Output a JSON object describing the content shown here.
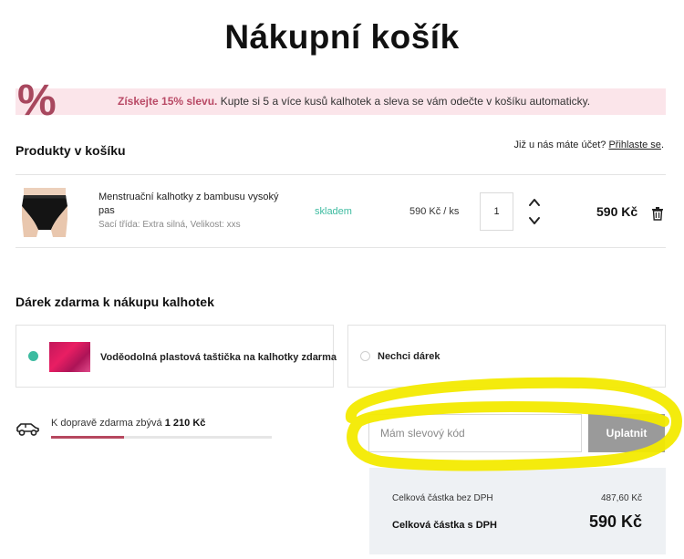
{
  "page": {
    "title": "Nákupní košík"
  },
  "promo": {
    "icon": "percent-icon",
    "symbol": "%",
    "strong": "Získejte 15% slevu.",
    "text": " Kupte si 5 a více kusů kalhotek a sleva se vám odečte v košíku automaticky.",
    "accent_color": "#b94a66",
    "background": "#fbe5ea"
  },
  "cart": {
    "heading": "Produkty v košíku",
    "login_prompt": "Již u nás máte účet? ",
    "login_link": "Přihlaste se",
    "login_suffix": ".",
    "items": [
      {
        "name": "Menstruační kalhotky z bambusu vysoký pas",
        "meta": "Sací třída: Extra silná, Velikost: xxs",
        "stock": "skladem",
        "unit_price": "590 Kč / ks",
        "quantity": "1",
        "total": "590 Kč",
        "icons": [
          "chevron-up-icon",
          "chevron-down-icon",
          "trash-icon"
        ]
      }
    ]
  },
  "gift": {
    "heading": "Dárek zdarma k nákupu kalhotek",
    "options": [
      {
        "label": "Voděodolná plastová taštička na kalhotky  zdarma",
        "selected": true
      },
      {
        "label": "Nechci dárek",
        "selected": false
      }
    ],
    "selected_color": "#3dbba0"
  },
  "shipping": {
    "icon": "car-icon",
    "text": "K dopravě zdarma zbývá ",
    "amount": "1 210 Kč",
    "progress": 0.33,
    "bar_color": "#b6485f"
  },
  "coupon": {
    "placeholder": "Mám slevový kód",
    "button": "Uplatnit"
  },
  "summary": {
    "without_vat_label": "Celková částka bez DPH",
    "without_vat_value": "487,60 Kč",
    "with_vat_label": "Celková částka s DPH",
    "with_vat_value": "590 Kč"
  },
  "annotation": {
    "color": "#f3ea00"
  }
}
